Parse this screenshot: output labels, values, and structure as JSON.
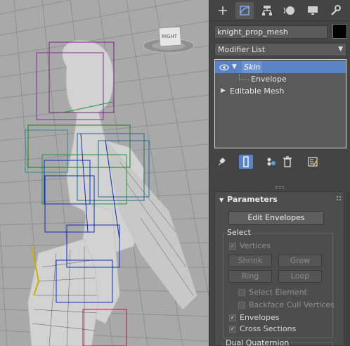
{
  "viewport": {
    "viewcube_label": "RIGHT"
  },
  "panel": {
    "tabs": [
      {
        "icon": "create-icon",
        "glyph": "+"
      },
      {
        "icon": "modify-icon",
        "glyph": ""
      },
      {
        "icon": "hierarchy-icon",
        "glyph": ""
      },
      {
        "icon": "motion-icon",
        "glyph": ""
      },
      {
        "icon": "display-icon",
        "glyph": ""
      },
      {
        "icon": "utilities-icon",
        "glyph": ""
      }
    ],
    "object_name": "knight_prop_mesh",
    "object_color": "#000000",
    "modifier_list": "Modifier List",
    "stack": {
      "skin": "Skin",
      "envelope": "Envelope",
      "editable_mesh": "Editable Mesh"
    },
    "parameters": {
      "title": "Parameters",
      "edit_envelopes": "Edit Envelopes",
      "select_group": "Select",
      "vertices": "Vertices",
      "shrink": "Shrink",
      "grow": "Grow",
      "ring": "Ring",
      "loop": "Loop",
      "select_element": "Select Element",
      "backface_cull": "Backface Cull Vertices",
      "envelopes": "Envelopes",
      "cross_sections": "Cross Sections",
      "dual_quaternion": "Dual Quaternion"
    },
    "accent_color": "#5a83c4"
  }
}
